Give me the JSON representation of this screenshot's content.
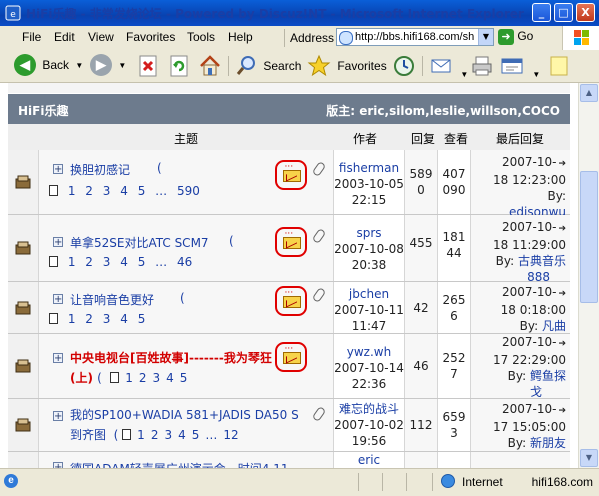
{
  "window": {
    "title": "HiFi乐趣 - 非常发烧论坛 - Powered by Discuz!NT - Microsoft Internet Explorer",
    "min": "_",
    "max": "□",
    "close": "X"
  },
  "menu": [
    "File",
    "Edit",
    "View",
    "Favorites",
    "Tools",
    "Help"
  ],
  "address": {
    "label": "Address",
    "url": "http://bbs.hifi168.com/sh",
    "go": "Go"
  },
  "toolbar": {
    "back": "Back",
    "search": "Search",
    "favorites": "Favorites"
  },
  "forum": {
    "name": "HiFi乐趣",
    "moderators": "版主: eric,silom,leslie,willson,COCO",
    "columns": {
      "topic": "主题",
      "author": "作者",
      "replies": "回复",
      "views": "查看",
      "last": "最后回复"
    }
  },
  "threads": [
    {
      "title": "换胆初感记",
      "hot": false,
      "paren": "(",
      "pages": [
        "1",
        "2",
        "3",
        "4",
        "5",
        "…",
        "590"
      ],
      "author": "fisherman",
      "date": "2003-10-05",
      "time": "22:15",
      "replies": [
        "589",
        "0"
      ],
      "views": [
        "407",
        "090"
      ],
      "last_date": "2007-10-",
      "last_time": "18 12:23:00",
      "last_by": "By:",
      "last_user": "edisonwu"
    },
    {
      "title": "单拿52SE对比ATC SCM7",
      "hot": false,
      "paren": "(",
      "pages": [
        "1",
        "2",
        "3",
        "4",
        "5",
        "…",
        "46"
      ],
      "author": "sprs",
      "date": "2007-10-08",
      "time": "20:38",
      "replies": [
        "455"
      ],
      "views": [
        "181",
        "44"
      ],
      "last_date": "2007-10-",
      "last_time": "18 11:29:00",
      "last_by": "By:",
      "last_user": "古典音乐",
      "last_user2": "888"
    },
    {
      "title": "让音响音色更好",
      "hot": false,
      "paren": "(",
      "pages": [
        "1",
        "2",
        "3",
        "4",
        "5"
      ],
      "author": "jbchen",
      "date": "2007-10-11",
      "time": "11:47",
      "replies": [
        "42"
      ],
      "views": [
        "265",
        "6"
      ],
      "last_date": "2007-10-",
      "last_time": "18 0:18:00",
      "last_by": "By:",
      "last_user": "凡曲"
    },
    {
      "title": "中央电视台[百姓故事]-------我为琴狂(上)",
      "hot": true,
      "paren": "(",
      "pages": [
        "1",
        "2",
        "3",
        "4",
        "5"
      ],
      "author": "ywz.wh",
      "date": "2007-10-14",
      "time": "22:36",
      "replies": [
        "46"
      ],
      "views": [
        "252",
        "7"
      ],
      "last_date": "2007-10-",
      "last_time": "17 22:29:00",
      "last_by": "By:",
      "last_user": "鳄鱼探",
      "last_user2": "戈"
    },
    {
      "title": "我的SP100+WADIA 581+JADIS DA50 S到齐图",
      "hot": false,
      "paren": "(",
      "pages": [
        "1",
        "2",
        "3",
        "4",
        "5",
        "…",
        "12"
      ],
      "author": "难忘的战斗",
      "date": "2007-10-02",
      "time": "19:56",
      "replies": [
        "112"
      ],
      "views": [
        "659",
        "3"
      ],
      "last_date": "2007-10-",
      "last_time": "17 15:05:00",
      "last_by": "By:",
      "last_user": "新朋友"
    },
    {
      "title": "德国ADAM轻声展广州演示会，时间4.11",
      "author": "eric"
    }
  ],
  "status": {
    "zone": "Internet",
    "site": "hifi168.com"
  },
  "colors": {
    "title_bar": "#0842b0",
    "forum_header": "#6d7b8d",
    "link": "#1a3ea5",
    "hot_title": "#d20000",
    "highlight_ring": "#e00000"
  }
}
